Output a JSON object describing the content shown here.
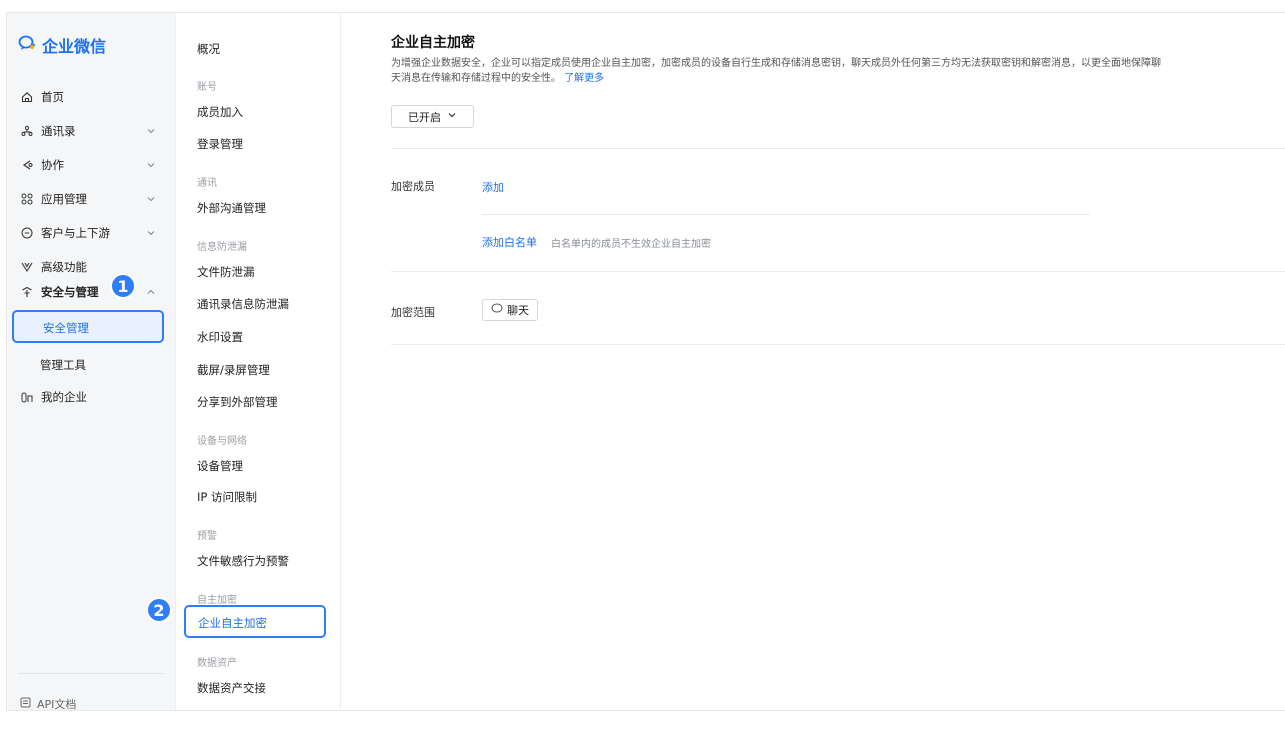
{
  "brand": {
    "name": "企业微信",
    "logo_icon": "wecom-logo-icon",
    "color": "#1f6ff2"
  },
  "nav": {
    "items": [
      {
        "label": "首页",
        "icon": "home-icon"
      },
      {
        "label": "通讯录",
        "icon": "contacts-icon"
      },
      {
        "label": "协作",
        "icon": "collaboration-icon"
      },
      {
        "label": "应用管理",
        "icon": "apps-icon"
      },
      {
        "label": "客户与上下游",
        "icon": "customer-icon"
      },
      {
        "label": "高级功能",
        "icon": "advanced-icon"
      },
      {
        "label": "安全与管理",
        "icon": "security-icon"
      }
    ],
    "security_sub": [
      "安全管理",
      "管理工具"
    ],
    "my_company": "我的企业",
    "api_doc": "API文档"
  },
  "badges": {
    "one": "1",
    "two": "2"
  },
  "subnav": {
    "overview": "概况",
    "groups": {
      "account": "账号",
      "communication": "通讯",
      "leak": "信息防泄漏",
      "device": "设备与网络",
      "warning": "预警",
      "encryption": "自主加密",
      "data": "数据资产"
    },
    "items": {
      "member_join": "成员加入",
      "login": "登录管理",
      "external": "外部沟通管理",
      "file_leak": "文件防泄漏",
      "contacts_leak": "通讯录信息防泄漏",
      "watermark": "水印设置",
      "screenshot": "截屏/录屏管理",
      "share_external": "分享到外部管理",
      "device_mgmt": "设备管理",
      "ip_limit": "IP 访问限制",
      "file_warning": "文件敏感行为预警",
      "self_encrypt": "企业自主加密",
      "data_exchange": "数据资产交接"
    }
  },
  "main": {
    "title": "企业自主加密",
    "desc_line1": "为增强企业数据安全，企业可以指定成员使用企业自主加密，加密成员的设备自行生成和存储消息密钥，聊天成员外任何第三方均无法获取密钥和解密消息，以更全面地保障聊",
    "desc_line2": "天消息在传输和存储过程中的安全性。",
    "learn_more": "了解更多",
    "status": "已开启",
    "members_label": "加密成员",
    "add": "添加",
    "add_whitelist": "添加白名单",
    "whitelist_hint": "白名单内的成员不生效企业自主加密",
    "scope_label": "加密范围",
    "scope_chat": "聊天"
  }
}
